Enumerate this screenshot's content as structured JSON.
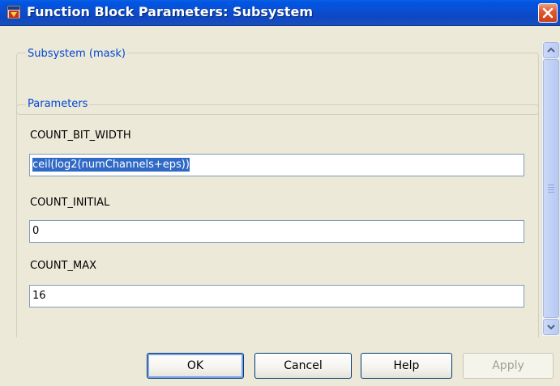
{
  "window": {
    "title": "Function Block Parameters: Subsystem",
    "icon": "simulink-block-icon",
    "close_icon": "close-icon"
  },
  "mask_group": {
    "legend": "Subsystem (mask)"
  },
  "parameters_group": {
    "legend": "Parameters",
    "fields": [
      {
        "label": "COUNT_BIT_WIDTH",
        "value": "ceil(log2(numChannels+eps))",
        "selected": true
      },
      {
        "label": "COUNT_INITIAL",
        "value": "0",
        "selected": false
      },
      {
        "label": "COUNT_MAX",
        "value": "16",
        "selected": false
      }
    ]
  },
  "buttons": {
    "ok": "OK",
    "cancel": "Cancel",
    "help": "Help",
    "apply": "Apply"
  },
  "colors": {
    "titlebar": "#0a4fd0",
    "legend_text": "#0046d5",
    "selection": "#316ac5",
    "close_button": "#e05a30"
  }
}
